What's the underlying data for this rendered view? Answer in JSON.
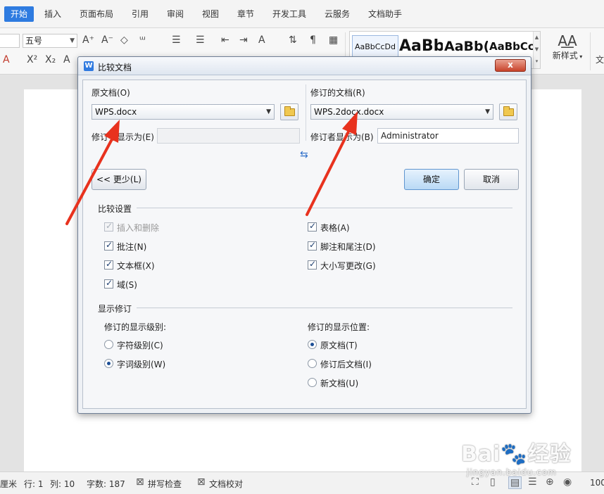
{
  "ribbon": {
    "tabs": [
      {
        "label": "开始"
      },
      {
        "label": "插入"
      },
      {
        "label": "页面布局"
      },
      {
        "label": "引用"
      },
      {
        "label": "审阅"
      },
      {
        "label": "视图"
      },
      {
        "label": "章节"
      },
      {
        "label": "开发工具"
      },
      {
        "label": "云服务"
      },
      {
        "label": "文档助手"
      }
    ],
    "active_color": "#2e7be0",
    "font_size": "五号",
    "styles": [
      "AaBbCcDd",
      "AaBb",
      "AaBb(",
      "AaBbCcI"
    ],
    "new_style_label": "新样式",
    "truncated_label": "文"
  },
  "dialog": {
    "title": "比较文档",
    "close_label": "x",
    "original": {
      "label": "原文档(O)",
      "file": "WPS.docx",
      "show_as_label": "修订者显示为(E)",
      "show_as_value": ""
    },
    "revised": {
      "label": "修订的文档(R)",
      "file": "WPS.2docx.docx",
      "show_as_label": "修订者显示为(B)",
      "show_as_value": "Administrator"
    },
    "less_button": "<< 更少(L)",
    "ok_button": "确定",
    "cancel_button": "取消",
    "compare_settings": {
      "title": "比较设置",
      "items": [
        {
          "label": "插入和删除",
          "checked": true,
          "disabled": true
        },
        {
          "label": "批注(N)",
          "checked": true,
          "disabled": false
        },
        {
          "label": "文本框(X)",
          "checked": true,
          "disabled": false
        },
        {
          "label": "域(S)",
          "checked": true,
          "disabled": false
        },
        {
          "label": "表格(A)",
          "checked": true,
          "disabled": false
        },
        {
          "label": "脚注和尾注(D)",
          "checked": true,
          "disabled": false
        },
        {
          "label": "大小写更改(G)",
          "checked": true,
          "disabled": false
        }
      ]
    },
    "show_changes": {
      "title": "显示修订",
      "level_label": "修订的显示级别:",
      "level_options": [
        {
          "label": "字符级别(C)",
          "selected": false
        },
        {
          "label": "字词级别(W)",
          "selected": true
        }
      ],
      "position_label": "修订的显示位置:",
      "position_options": [
        {
          "label": "原文档(T)",
          "selected": true
        },
        {
          "label": "修订后文档(I)",
          "selected": false
        },
        {
          "label": "新文档(U)",
          "selected": false
        }
      ]
    }
  },
  "statusbar": {
    "unit": "厘米",
    "line": "行: 1",
    "column": "列: 10",
    "word_count": "字数: 187",
    "spell_check": "拼写检查",
    "doc_proof": "文档校对",
    "zoom": "100"
  },
  "watermark": {
    "brand": "Bai🐾经验",
    "url": "jingyan.baidu.com"
  },
  "annotation_color": "#e8321e"
}
